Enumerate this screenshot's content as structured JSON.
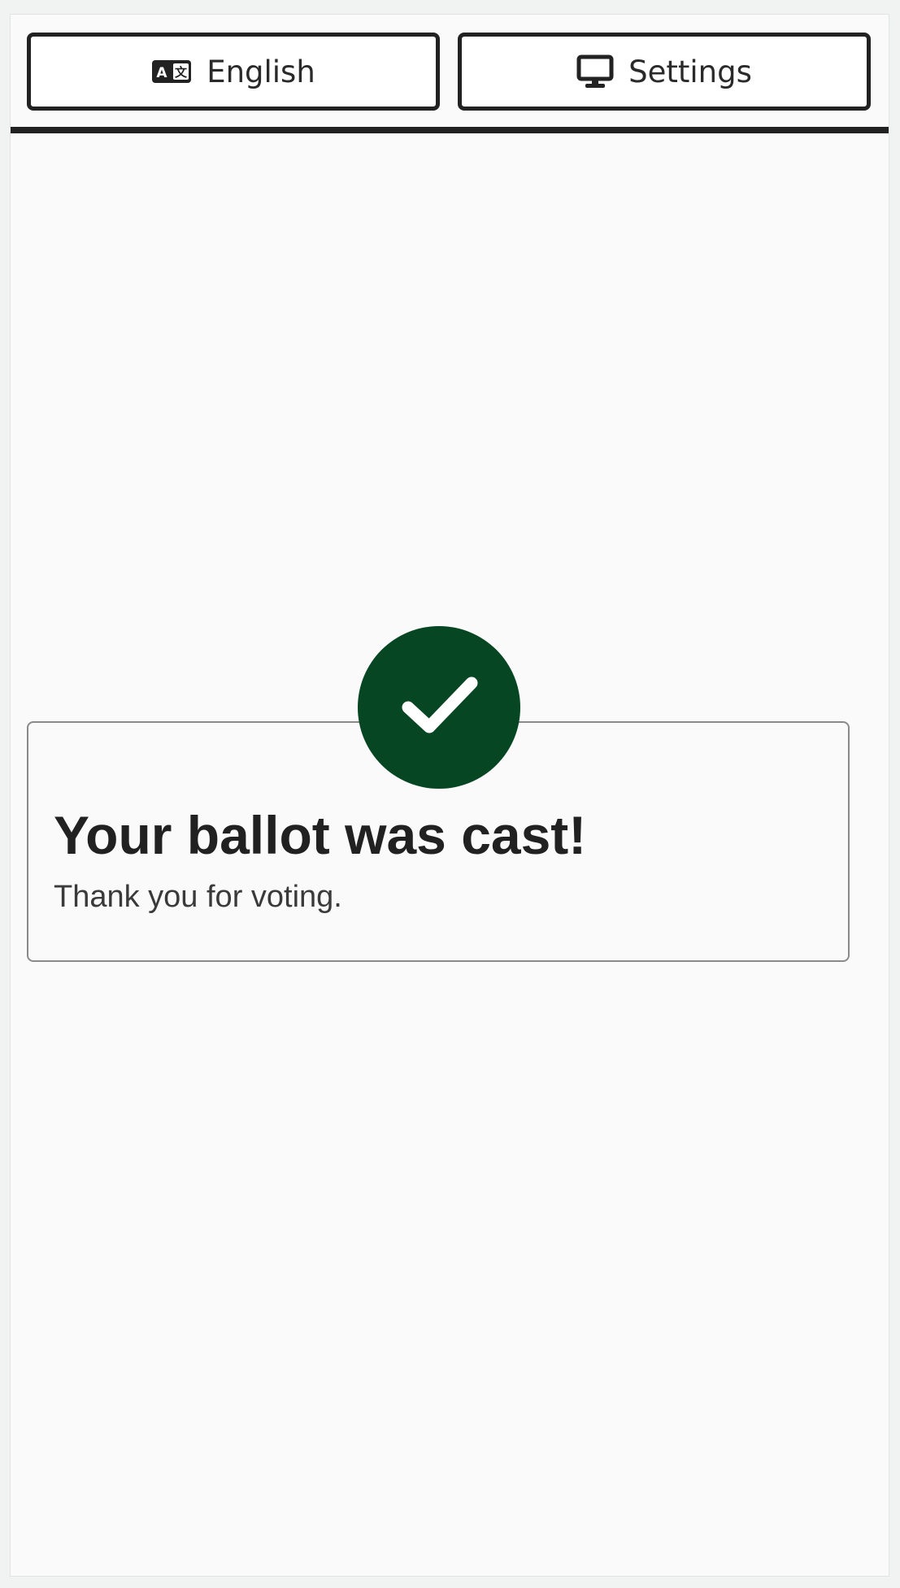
{
  "topbar": {
    "language_button": {
      "label": "English",
      "icon": "language-icon"
    },
    "settings_button": {
      "label": "Settings",
      "icon": "monitor-icon"
    }
  },
  "confirmation": {
    "icon": "checkmark-icon",
    "title": "Your ballot was cast!",
    "message": "Thank you for voting.",
    "accent_color": "#064622"
  }
}
